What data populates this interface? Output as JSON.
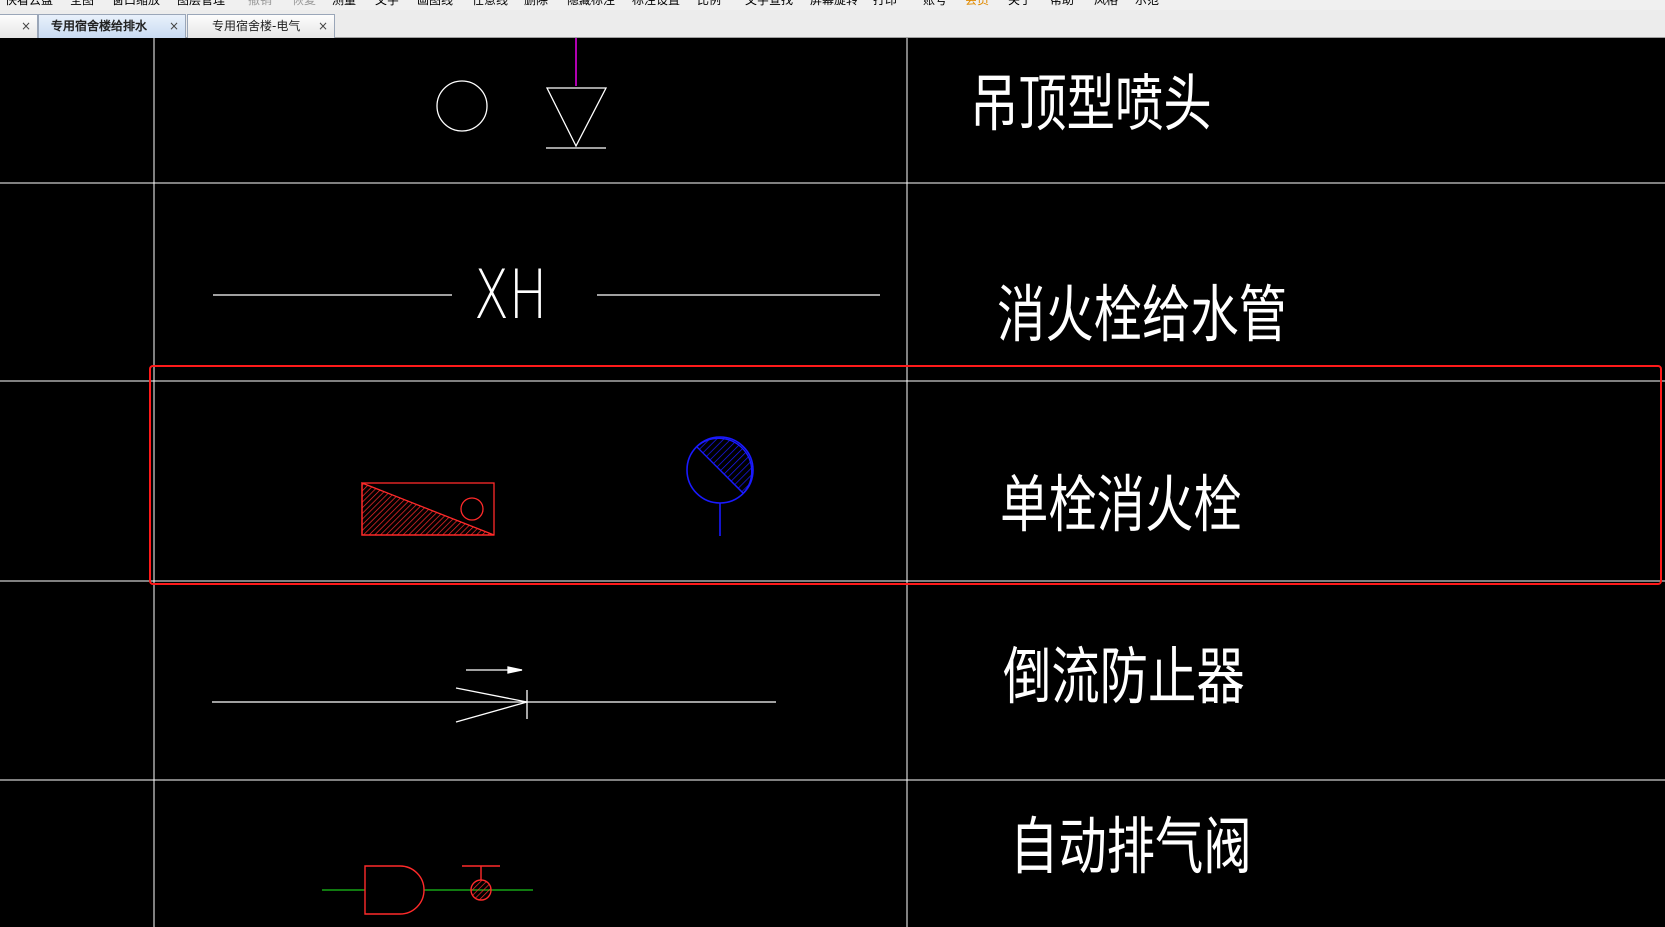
{
  "menu": {
    "items": [
      {
        "label": "快看云盘",
        "state": "normal"
      },
      {
        "label": "全图",
        "state": "normal"
      },
      {
        "label": "窗口缩放",
        "state": "normal"
      },
      {
        "label": "图层管理",
        "state": "normal"
      },
      {
        "label": "撤销",
        "state": "disabled"
      },
      {
        "label": "恢复",
        "state": "disabled"
      },
      {
        "label": "测量",
        "state": "normal"
      },
      {
        "label": "文字",
        "state": "normal"
      },
      {
        "label": "画图线",
        "state": "normal"
      },
      {
        "label": "任意线",
        "state": "normal"
      },
      {
        "label": "删除",
        "state": "normal"
      },
      {
        "label": "隐藏标注",
        "state": "normal"
      },
      {
        "label": "标注设置",
        "state": "normal"
      },
      {
        "label": "比例",
        "state": "normal"
      },
      {
        "label": "文字查找",
        "state": "normal"
      },
      {
        "label": "屏幕旋转",
        "state": "normal"
      },
      {
        "label": "打印",
        "state": "normal"
      },
      {
        "label": "账号",
        "state": "normal"
      },
      {
        "label": "会员",
        "state": "vip"
      },
      {
        "label": "关于",
        "state": "normal"
      },
      {
        "label": "帮助",
        "state": "normal"
      },
      {
        "label": "风格",
        "state": "normal"
      },
      {
        "label": "示范",
        "state": "normal"
      }
    ]
  },
  "tabs": [
    {
      "label": "专用宿舍楼给排水",
      "active": true,
      "close": "×"
    },
    {
      "label": "专用宿舍楼-电气",
      "active": false,
      "close": "×"
    }
  ],
  "drawing": {
    "symbol_xh_label": "XH",
    "rows": [
      {
        "symbol": "ceiling-sprinkler",
        "description": "吊顶型喷头"
      },
      {
        "symbol": "hydrant-pipe",
        "description": "消火栓给水管"
      },
      {
        "symbol": "single-hydrant",
        "description": "单栓消火栓"
      },
      {
        "symbol": "backflow-preventer",
        "description": "倒流防止器"
      },
      {
        "symbol": "auto-air-valve",
        "description": "自动排气阀"
      }
    ],
    "highlight_color": "#ff1a1a",
    "line_color": "#ffffff",
    "blue_symbol_color": "#1a1aff",
    "red_symbol_color": "#ff2a2a",
    "green_line_color": "#19c419",
    "purple_line_color": "#b000b0"
  }
}
